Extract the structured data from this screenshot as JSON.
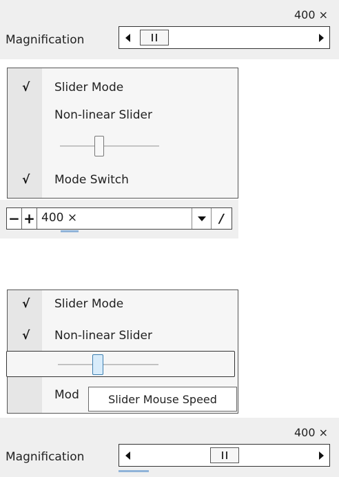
{
  "top_panel": {
    "zoom_value": "400 ×",
    "label": "Magnification"
  },
  "menu1": {
    "items": [
      {
        "check": "√",
        "label": "Slider Mode"
      },
      {
        "check": "",
        "label": "Non-linear Slider"
      },
      {
        "check": "√",
        "label": "Mode Switch"
      }
    ]
  },
  "zoom_toolbar": {
    "minus": "−",
    "plus": "+",
    "value": "400 ×",
    "edit_glyph": "/"
  },
  "menu2": {
    "items": [
      {
        "check": "√",
        "label": "Slider Mode"
      },
      {
        "check": "√",
        "label": "Non-linear Slider"
      },
      {
        "check": "",
        "label": "Mod"
      }
    ],
    "tooltip": "Slider Mouse Speed"
  },
  "bottom_panel": {
    "zoom_value": "400 ×",
    "label": "Magnification"
  }
}
